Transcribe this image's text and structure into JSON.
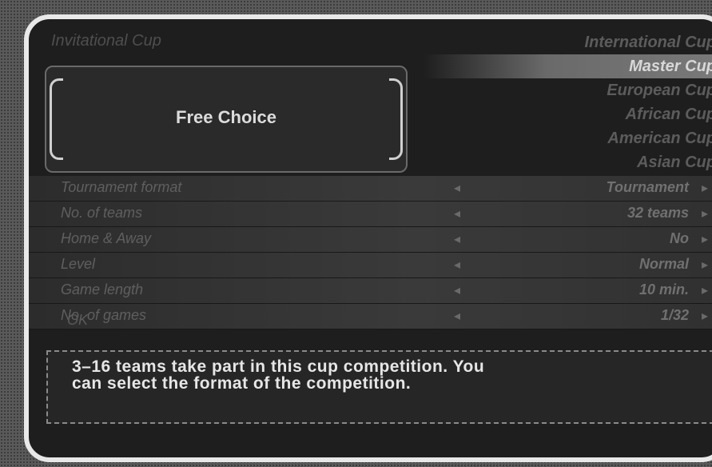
{
  "top_title": "Invitational Cup",
  "free_choice": {
    "label": "Free Choice"
  },
  "cups": [
    {
      "label": "International Cup",
      "selected": false
    },
    {
      "label": "Master Cup",
      "selected": true
    },
    {
      "label": "European Cup",
      "selected": false
    },
    {
      "label": "African Cup",
      "selected": false
    },
    {
      "label": "American Cup",
      "selected": false
    },
    {
      "label": "Asian Cup",
      "selected": false
    }
  ],
  "settings": [
    {
      "label": "Tournament format",
      "value": "Tournament"
    },
    {
      "label": "No. of teams",
      "value": "32 teams"
    },
    {
      "label": "Home & Away",
      "value": "No"
    },
    {
      "label": "Level",
      "value": "Normal"
    },
    {
      "label": "Game length",
      "value": "10 min."
    },
    {
      "label": "No. of games",
      "value": "1/32"
    }
  ],
  "ok_label": "OK",
  "description": {
    "line1": "3–16 teams take part in this cup competition. You",
    "line2": "can select the format of the competition."
  },
  "arrows": {
    "left": "◂",
    "right": "▸"
  }
}
